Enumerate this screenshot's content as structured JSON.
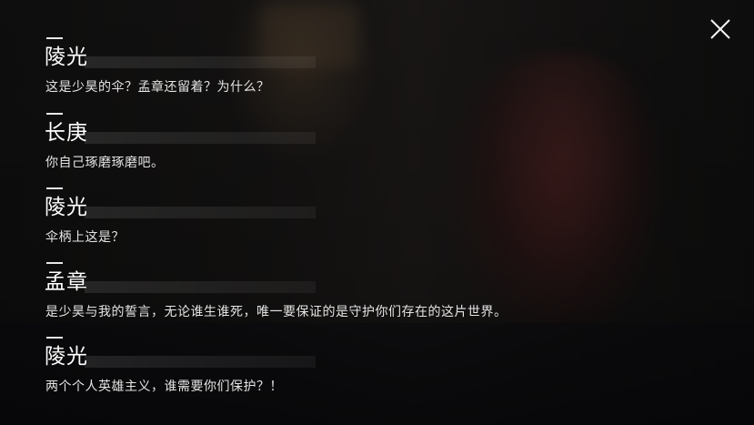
{
  "dialogue_log": [
    {
      "speaker": "陵光",
      "text": "这是少昊的伞？孟章还留着？为什么？"
    },
    {
      "speaker": "长庚",
      "text": "你自己琢磨琢磨吧。"
    },
    {
      "speaker": "陵光",
      "text": "伞柄上这是？"
    },
    {
      "speaker": "孟章",
      "text": "是少昊与我的誓言，无论谁生谁死，唯一要保证的是守护你们存在的这片世界。"
    },
    {
      "speaker": "陵光",
      "text": "两个个人英雄主义，谁需要你们保护？！"
    }
  ],
  "close_icon": "close-icon"
}
